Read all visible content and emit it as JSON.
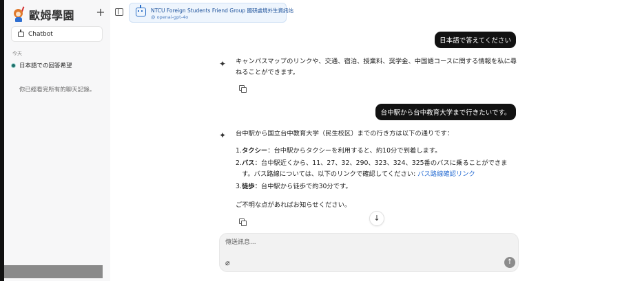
{
  "app": {
    "logo_text": "歐姆學園",
    "new_chat_icon": "plus-icon"
  },
  "sidebar": {
    "chatbot_label": "Chatbot",
    "section_today": "今天",
    "history": [
      {
        "label": "日本語での回答希望"
      }
    ],
    "history_end_note": "你已經看完所有的聊天記錄。"
  },
  "header": {
    "bot_title": "NTCU Foreign Students Friend Group 國研處境外生資訊站",
    "bot_model": "@ openai-gpt-4o"
  },
  "conversation": {
    "user_1": "日本語で答えてください",
    "assistant_1": "キャンパスマップのリンクや、交通、宿泊、授業料、奨学金、中国語コースに関する情報を私に尋ねることができます。",
    "user_2": "台中駅から台中教育大学まで行きたいです。",
    "assistant_2_intro": "台中駅から国立台中教育大学（民生校区）までの行き方は以下の通りです：",
    "assistant_2_items": [
      {
        "num": "1.",
        "title": "タクシー",
        "text": "：台中駅からタクシーを利用すると、約10分で到着します。"
      },
      {
        "num": "2.",
        "title": "バス",
        "text": "：台中駅近くから、11、27、32、290、323、324、325番のバスに乗ることができます。バス路線については、以下のリンクで確認してください: ",
        "link": "バス路線確認リンク"
      },
      {
        "num": "3.",
        "title": "徒歩",
        "text": "：台中駅から徒歩で約30分です。"
      }
    ],
    "assistant_2_outro": "ご不明な点があればお知らせください。"
  },
  "composer": {
    "placeholder": "傳送訊息..."
  },
  "colors": {
    "user_bubble": "#121212",
    "link": "#2b6fd3",
    "chip_bg": "#eef5fd"
  }
}
